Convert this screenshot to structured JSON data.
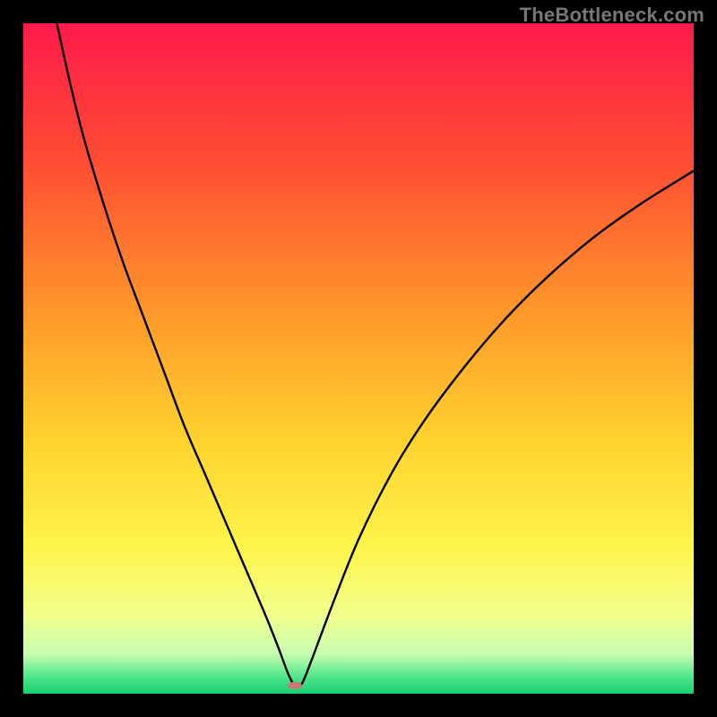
{
  "watermark": "TheBottleneck.com",
  "chart_data": {
    "type": "line",
    "title": "",
    "xlabel": "",
    "ylabel": "",
    "xlim": [
      0,
      100
    ],
    "ylim": [
      0,
      100
    ],
    "grid": false,
    "legend": false,
    "gradient_stops": [
      {
        "offset": 0.0,
        "color": "#ff1a4b"
      },
      {
        "offset": 0.2,
        "color": "#ff4b33"
      },
      {
        "offset": 0.45,
        "color": "#ff9e2a"
      },
      {
        "offset": 0.62,
        "color": "#ffd22e"
      },
      {
        "offset": 0.78,
        "color": "#fff44a"
      },
      {
        "offset": 0.88,
        "color": "#f3ff8a"
      },
      {
        "offset": 0.94,
        "color": "#c8ffb0"
      },
      {
        "offset": 0.975,
        "color": "#52e58c"
      },
      {
        "offset": 1.0,
        "color": "#17cf74"
      }
    ],
    "series": [
      {
        "name": "bottleneck-curve",
        "x": [
          5,
          7,
          9,
          12,
          15,
          18,
          21,
          24,
          27,
          30,
          33,
          36,
          38,
          39.5,
          40.5,
          41.5,
          43,
          46,
          50,
          55,
          60,
          66,
          72,
          78,
          85,
          92,
          100
        ],
        "y": [
          100,
          91,
          83,
          73,
          64,
          56,
          48,
          40,
          33,
          26,
          19,
          12,
          7,
          3,
          1.2,
          1.4,
          5,
          13,
          23,
          33,
          41,
          49,
          56,
          62,
          68,
          73,
          78
        ]
      }
    ],
    "marker": {
      "x": 40.5,
      "y": 1.2,
      "color": "#c87a7a"
    }
  }
}
